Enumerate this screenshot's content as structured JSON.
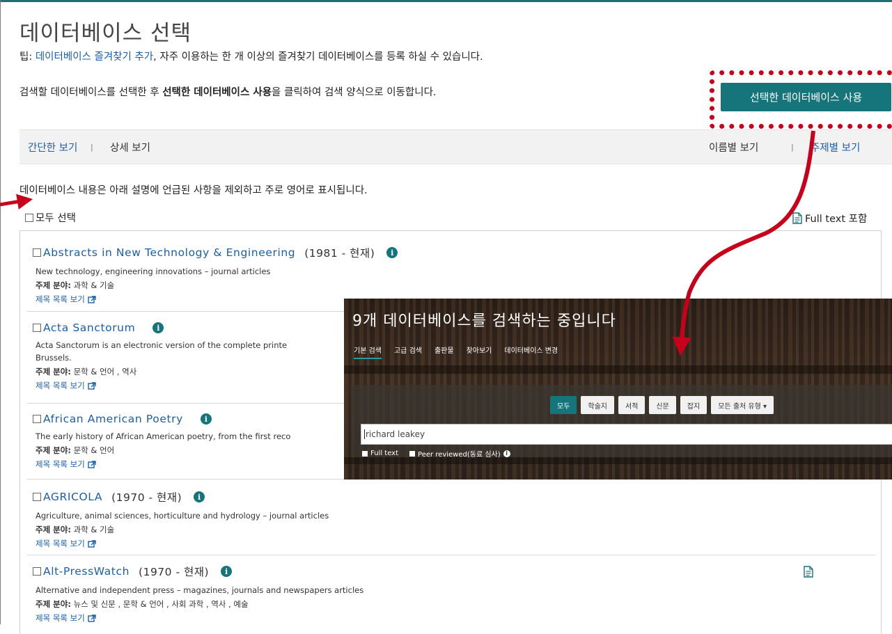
{
  "header": {
    "title": "데이터베이스 선택",
    "tip_prefix": "팁: ",
    "tip_link": "데이터베이스 즐겨찾기 추가",
    "tip_suffix": ", 자주 이용하는 한 개 이상의 즐겨찾기 데이터베이스를 등록 하실 수 있습니다.",
    "instruction_prefix": "검색할 데이터베이스를 선택한 후 ",
    "instruction_bold": "선택한 데이터베이스 사용",
    "instruction_suffix": "을 클릭하여 검색 양식으로 이동합니다.",
    "use_button": "선택한 데이터베이스 사용"
  },
  "viewbar": {
    "simple": "간단한 보기",
    "separator": "|",
    "detail": "상세 보기",
    "by_name": "이름별 보기",
    "by_subject": "주제별 보기"
  },
  "note": "데이터베이스 내용은 아래 설명에 언급된 사항을 제외하고 주로 영어로 표시됩니다.",
  "select_all": "모두 선택",
  "fulltext_legend": "Full text 포함",
  "databases": [
    {
      "name": "Abstracts in New Technology & Engineering",
      "years": "(1981 - 현재)",
      "desc": "New technology, engineering innovations – journal articles",
      "subject_label": "주제 분야:",
      "subjects": " 과학 & 기술",
      "titles_link": "제목 목록 보기"
    },
    {
      "name": "Acta Sanctorum",
      "years": "",
      "desc": "Acta Sanctorum is an electronic version of the complete printe",
      "desc2": "Brussels.",
      "subject_label": "주제 분야:",
      "subjects": " 문학 & 언어 , 역사",
      "titles_link": "제목 목록 보기"
    },
    {
      "name": "African American Poetry",
      "years": "",
      "desc": "The early history of African American poetry, from the first reco",
      "subject_label": "주제 분야:",
      "subjects": " 문학 & 언어",
      "titles_link": "제목 목록 보기"
    },
    {
      "name": "AGRICOLA",
      "years": "(1970 - 현재)",
      "desc": "Agriculture, animal sciences, horticulture and hydrology – journal articles",
      "subject_label": "주제 분야:",
      "subjects": " 과학 & 기술",
      "titles_link": "제목 목록 보기"
    },
    {
      "name": "Alt-PressWatch",
      "years": "(1970 - 현재)",
      "desc": "Alternative and independent press – magazines, journals and newspapers articles",
      "subject_label": "주제 분야:",
      "subjects": " 뉴스 및 신문 , 문학 & 언어 , 사회 과학 , 역사 , 예술",
      "titles_link": "제목 목록 보기"
    }
  ],
  "overlay": {
    "title": "9개 데이터베이스를 검색하는 중입니다",
    "tabs": [
      "기본 검색",
      "고급 검색",
      "출판물",
      "찾아보기",
      "데이터베이스 변경"
    ],
    "filters": [
      "모두",
      "학술지",
      "서적",
      "신문",
      "잡지",
      "모든 출처 유형 ▾"
    ],
    "search_value": "richard leakey",
    "opt_fulltext": "Full text",
    "opt_peer": "Peer reviewed(동료 심사)"
  },
  "colors": {
    "accent": "#16747b",
    "link": "#1a5fa8",
    "annotation": "#c8001a"
  }
}
